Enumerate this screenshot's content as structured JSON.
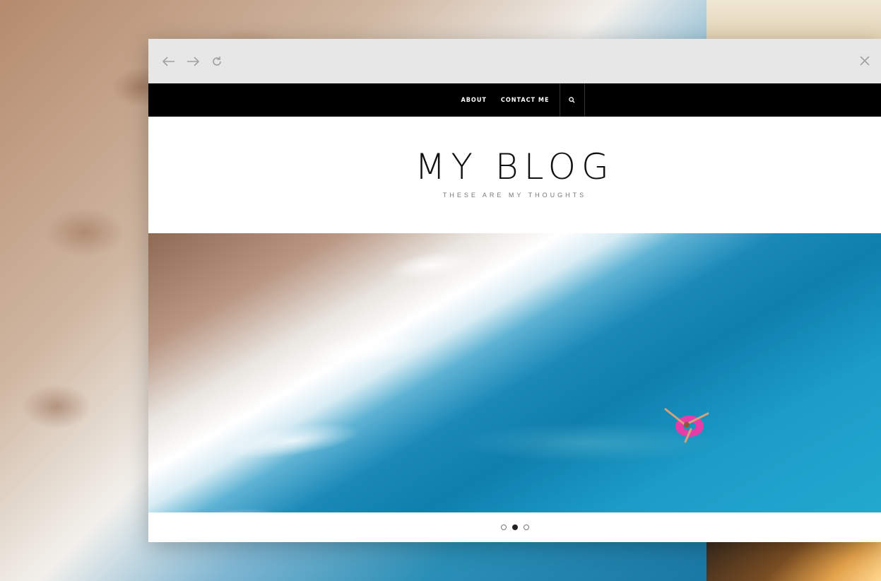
{
  "browser": {
    "toolbar": {
      "back_icon": "arrow-left-icon",
      "forward_icon": "arrow-right-icon",
      "reload_icon": "reload-icon",
      "close_icon": "close-icon"
    }
  },
  "nav": {
    "items": [
      {
        "label": "ABOUT"
      },
      {
        "label": "CONTACT ME"
      }
    ],
    "search_icon": "search-icon"
  },
  "header": {
    "title": "MY BLOG",
    "tagline": "THESE ARE MY THOUGHTS"
  },
  "slider": {
    "dots": 3,
    "active_index": 1
  },
  "colors": {
    "nav_bg": "#000000",
    "toolbar_bg": "#e7e7e7",
    "page_bg": "#ffffff",
    "float_pink": "#e63ea8"
  }
}
